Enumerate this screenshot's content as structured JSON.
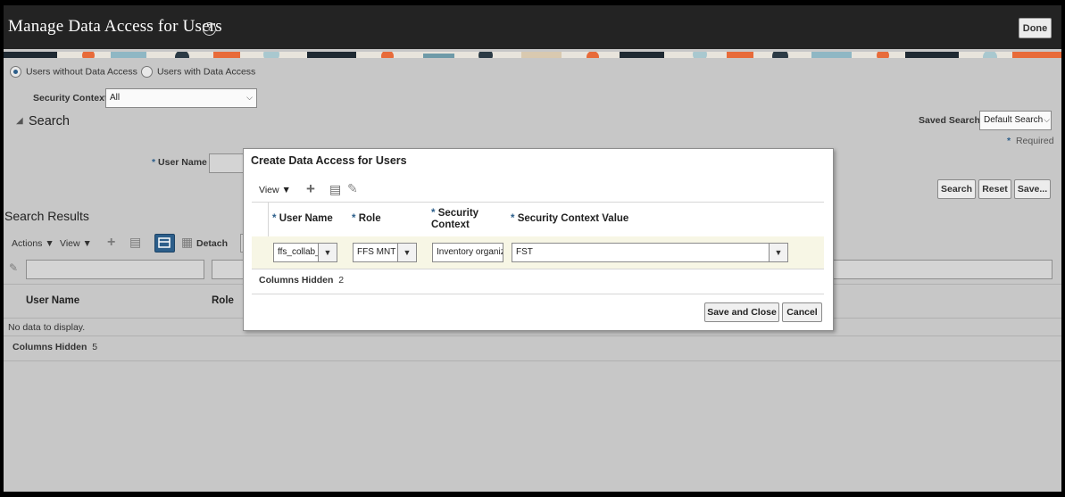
{
  "header": {
    "title": "Manage Data Access for Users",
    "done_label": "Done"
  },
  "filters": {
    "radio_without": "Users without Data Access",
    "radio_with": "Users with Data Access",
    "security_context_label": "Security Context",
    "security_context_value": "All"
  },
  "search": {
    "heading": "Search",
    "saved_search_label": "Saved Search",
    "saved_search_value": "Default Search",
    "required_label": "Required",
    "user_name_label": "User Name",
    "buttons": {
      "search": "Search",
      "reset": "Reset",
      "save": "Save..."
    }
  },
  "results": {
    "heading": "Search Results",
    "actions_label": "Actions",
    "view_label": "View",
    "detach_label": "Detach",
    "columns": [
      "User Name",
      "Role"
    ],
    "empty_text": "No data to display.",
    "columns_hidden_label": "Columns Hidden",
    "columns_hidden_count": "5"
  },
  "dialog": {
    "title": "Create Data Access for Users",
    "view_label": "View",
    "columns": {
      "user_name": "User Name",
      "role": "Role",
      "security_context_line1": "Security",
      "security_context_line2": "Context",
      "security_context_value": "Security Context Value"
    },
    "row": {
      "user_name": "ffs_collab_",
      "role": "FFS MNT I",
      "security_context": "Inventory organiz",
      "security_context_value": "FST"
    },
    "columns_hidden_label": "Columns Hidden",
    "columns_hidden_count": "2",
    "save_close_label": "Save and Close",
    "cancel_label": "Cancel"
  },
  "colors": {
    "header_bg": "#232323",
    "accent": "#2c5e8a",
    "row_highlight": "#f7f6e5"
  }
}
